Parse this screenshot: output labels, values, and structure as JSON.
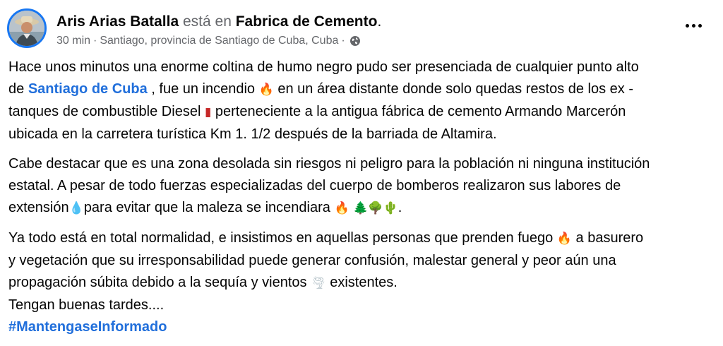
{
  "post": {
    "author": "Aris Arias Batalla",
    "at_text": "está en",
    "place": "Fabrica de Cemento",
    "place_suffix": ".",
    "time": "30 min",
    "separator": "·",
    "location": "Santiago, provincia de Santiago de Cuba, Cuba",
    "separator2": "·",
    "privacy_icon": "globe-icon",
    "more_icon": "more-options-icon"
  },
  "content": {
    "p1": {
      "l1": "Hace unos minutos una enorme coltina de humo negro pudo ser presenciada de cualquier punto alto",
      "l2_a": "de ",
      "l2_link": "Santiago de Cuba",
      "l2_b": " , fue un incendio ",
      "l2_c": " en un área distante donde solo quedas restos de los ex -",
      "l3_a": "tanques de combustible Diesel ",
      "l3_b": " perteneciente a la antigua fábrica de cemento Armando Marcerón",
      "l4": "ubicada en la carretera turística Km 1. 1/2 después de la barriada de Altamira."
    },
    "p2": {
      "l1": "Cabe destacar que es una zona desolada sin riesgos ni peligro para la población ni ninguna institución",
      "l2": "estatal. A pesar de todo fuerzas especializadas del cuerpo de bomberos realizaron sus labores de",
      "l3_a": "extensión",
      "l3_b": "para evitar que la maleza se incendiara ",
      "l3_c": "."
    },
    "p3": {
      "l1_a": "Ya todo está en total normalidad, e insistimos en aquellas personas que prenden fuego ",
      "l1_b": " a basurero",
      "l2": "y vegetación que su irresponsabilidad puede generar confusión, malestar general y peor aún una",
      "l3_a": "propagación súbita debido a la sequía y vientos ",
      "l3_b": " existentes.",
      "l4": "Tengan buenas tardes....",
      "hashtag": "#MantengaseInformado"
    }
  },
  "emoji": {
    "fire": "🔥",
    "fuel_can": "▮",
    "droplet": "💧",
    "evergreen": "🌲",
    "tree": "🌳",
    "cactus": "🌵",
    "tornado": "🌪"
  },
  "colors": {
    "link": "#216fdb",
    "meta": "#65676b",
    "avatar_ring": "#1877f2"
  }
}
